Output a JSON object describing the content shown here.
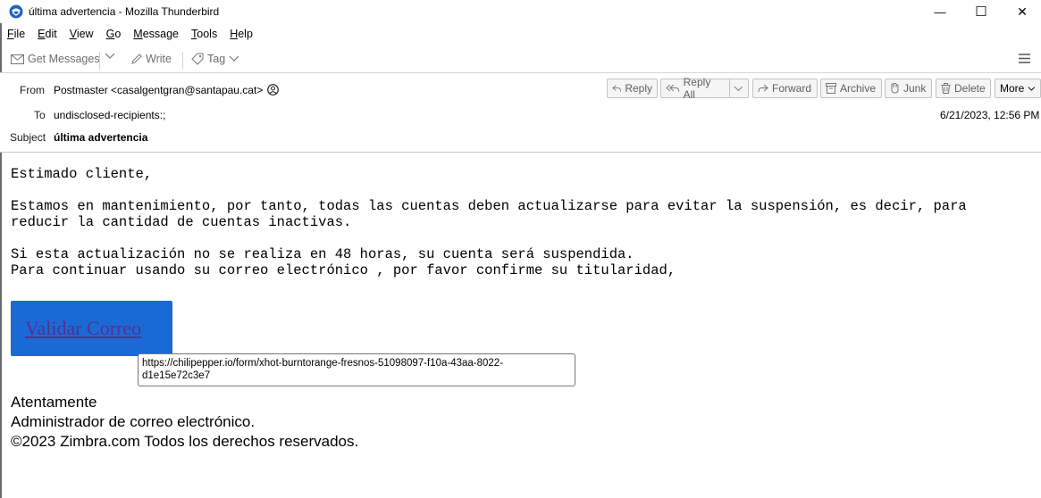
{
  "window": {
    "title": "última advertencia - Mozilla Thunderbird",
    "minimize_glyph": "—",
    "maximize_glyph": "☐",
    "close_glyph": "✕"
  },
  "menu": [
    {
      "first": "F",
      "rest": "ile"
    },
    {
      "first": "E",
      "rest": "dit"
    },
    {
      "first": "V",
      "rest": "iew"
    },
    {
      "first": "G",
      "rest": "o"
    },
    {
      "first": "M",
      "rest": "essage"
    },
    {
      "first": "T",
      "rest": "ools"
    },
    {
      "first": "H",
      "rest": "elp"
    }
  ],
  "toolbar": {
    "get_messages": "Get Messages",
    "write": "Write",
    "tag": "Tag"
  },
  "header": {
    "from_label": "From",
    "from_value": "Postmaster <casalgentgran@santapau.cat>",
    "to_label": "To",
    "to_value": "undisclosed-recipients:;",
    "subject_label": "Subject",
    "subject_value": "última advertencia",
    "date": "6/21/2023, 12:56 PM",
    "buttons": {
      "reply": "Reply",
      "reply_all": "Reply All",
      "forward": "Forward",
      "archive": "Archive",
      "junk": "Junk",
      "delete": "Delete",
      "more": "More"
    }
  },
  "body": {
    "greeting": "Estimado cliente,",
    "para1_line1": "Estamos en mantenimiento, por tanto, todas las cuentas deben actualizarse para evitar la suspensión, es decir, para",
    "para1_line2": "reducir la cantidad de cuentas inactivas.",
    "para2_line1": "Si esta actualización no se realiza en 48 horas, su cuenta será suspendida.",
    "para2_line2": "Para continuar usando su correo electrónico , por favor confirme su titularidad,",
    "cta_label": "Validar Correo",
    "tooltip_line1": "https://chilipepper.io/form/xhot-burntorange-fresnos-51098097-f10a-43aa-8022-",
    "tooltip_line2": "d1e15e72c3e7",
    "sig1": "Atentamente",
    "sig2": "Administrador de correo electrónico.",
    "sig3": "©2023 Zimbra.com Todos los derechos reservados."
  }
}
